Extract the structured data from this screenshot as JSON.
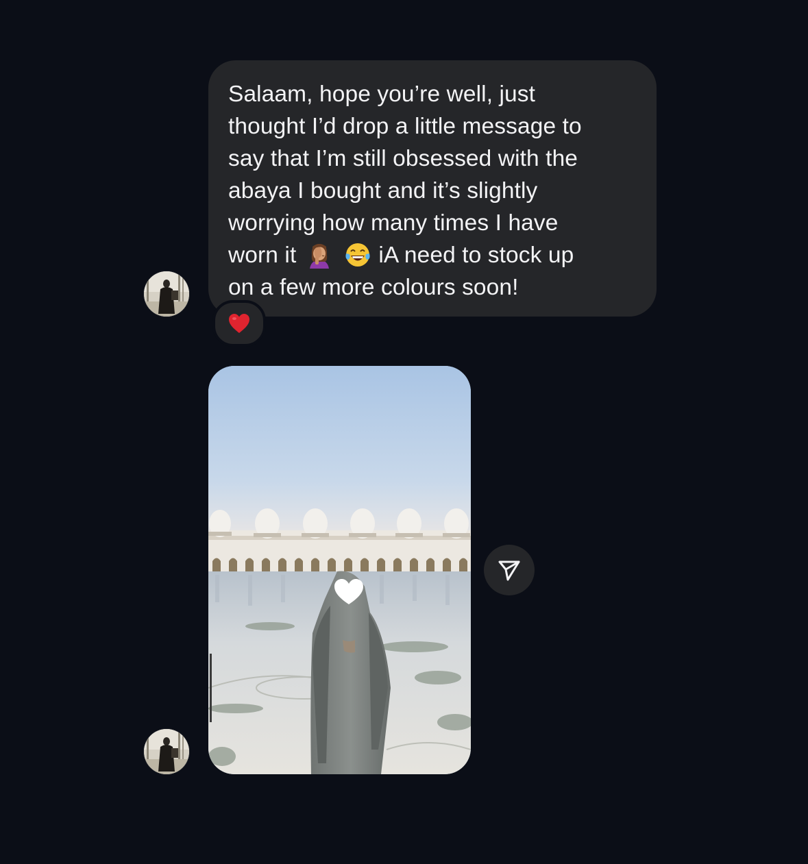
{
  "conversation": {
    "messages": [
      {
        "type": "text",
        "lines": [
          "Salaam, hope you’re well, just",
          "thought I’d drop a little message to",
          "say that I’m still obsessed with the",
          "abaya I bought and it’s slightly",
          "worrying how many times I have"
        ],
        "line6_start": "worn it",
        "line6_emojis": [
          "woman-facepalming-emoji",
          "face-with-tears-of-joy-emoji"
        ],
        "line6_end": "iA need to stock up",
        "line7": "on a few more colours soon!",
        "reaction": "red-heart-emoji"
      },
      {
        "type": "photo",
        "image": "woman-in-grey-abaya-at-white-domed-mosque-courtyard",
        "face_cover": "white-heart-sticker",
        "action_icon": "paper-plane-share-icon"
      }
    ]
  },
  "colors": {
    "background": "#0b0e17",
    "bubble": "#252629",
    "text": "#f3f3f5",
    "heart": "#e0242f"
  }
}
